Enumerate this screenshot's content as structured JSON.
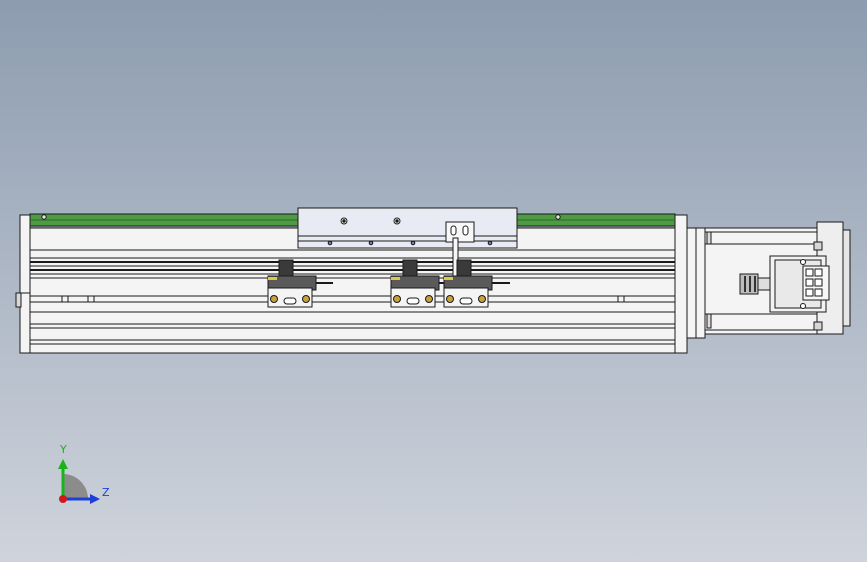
{
  "viewport": {
    "background_top": "#8d9cb0",
    "background_bottom": "#cfd4dc"
  },
  "model": {
    "outline_color": "#1a1a1a",
    "body_fill": "#f4f4f4",
    "rail_fill": "#4f9a45",
    "carriage_fill": "#e9ebf4",
    "sensor_fill": "#3a3a3a",
    "brass_color": "#c9a23a"
  },
  "triad": {
    "y_label": "Y",
    "z_label": "Z",
    "y_axis_color": "#19b419",
    "z_axis_color": "#1c3fd8",
    "origin_color": "#d01a1a"
  }
}
